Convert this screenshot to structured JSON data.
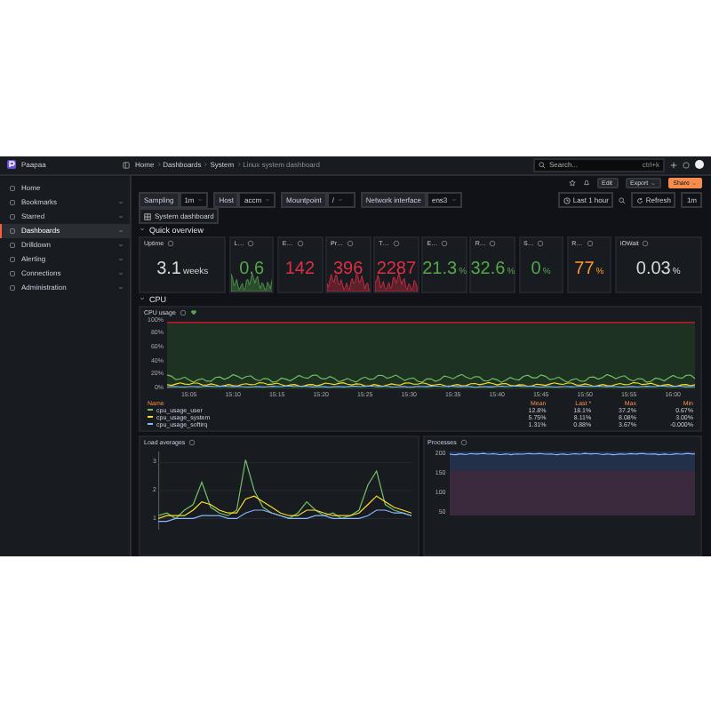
{
  "app": {
    "name": "Paapaa"
  },
  "breadcrumbs": [
    "Home",
    "Dashboards",
    "System",
    "Linux system dashboard"
  ],
  "search": {
    "placeholder": "Search...",
    "shortcut": "ctrl+k"
  },
  "sidebar": {
    "items": [
      {
        "label": "Home",
        "selected": false,
        "expandable": false
      },
      {
        "label": "Bookmarks",
        "selected": false,
        "expandable": true
      },
      {
        "label": "Starred",
        "selected": false,
        "expandable": true
      },
      {
        "label": "Dashboards",
        "selected": true,
        "expandable": true
      },
      {
        "label": "Drilldown",
        "selected": false,
        "expandable": true
      },
      {
        "label": "Alerting",
        "selected": false,
        "expandable": true
      },
      {
        "label": "Connections",
        "selected": false,
        "expandable": true
      },
      {
        "label": "Administration",
        "selected": false,
        "expandable": true
      }
    ]
  },
  "toolbar": {
    "buttons": [
      {
        "label": "Edit",
        "kind": "plain"
      },
      {
        "label": "Export",
        "kind": "dropdown"
      },
      {
        "label": "Share",
        "kind": "primary"
      }
    ]
  },
  "variables": [
    {
      "label": "Sampling",
      "value": "1m"
    },
    {
      "label": "Host",
      "value": "accm"
    },
    {
      "label": "Mountpoint",
      "value": "/"
    },
    {
      "label": "Network interface",
      "value": "ens3"
    }
  ],
  "time_range": "Last 1 hour",
  "refresh": {
    "label": "Refresh",
    "interval": "1m"
  },
  "dashboard_link": "System dashboard",
  "quick_overview": {
    "title": "Quick overview",
    "expanded": true,
    "stats": [
      {
        "title": "Uptime",
        "value": "3.1",
        "unit": "weeks",
        "color": "#d8d9da",
        "graph": false
      },
      {
        "title": "L…",
        "value": "0.6",
        "color": "#56a64b",
        "graph": true
      },
      {
        "title": "E…",
        "value": "142",
        "color": "#e02f44",
        "graph": false
      },
      {
        "title": "Pr…",
        "value": "396",
        "color": "#e02f44",
        "graph": true
      },
      {
        "title": "T…",
        "value": "2287",
        "color": "#e02f44",
        "graph": true
      },
      {
        "title": "E…",
        "value": "21.3",
        "unit": "%",
        "color": "#56a64b",
        "graph": false
      },
      {
        "title": "R…",
        "value": "32.6",
        "unit": "%",
        "color": "#56a64b",
        "graph": false
      },
      {
        "title": "S…",
        "value": "0",
        "unit": "%",
        "color": "#56a64b",
        "graph": false
      },
      {
        "title": "R…",
        "value": "77",
        "unit": "%",
        "color": "#ff9830",
        "graph": false
      },
      {
        "title": "IOWait",
        "value": "0.03",
        "unit": "%",
        "color": "#d8d9da",
        "graph": false
      }
    ]
  },
  "cpu": {
    "title": "CPU",
    "expanded": true,
    "panel": {
      "title": "CPU usage",
      "yticks": [
        "100%",
        "80%",
        "60%",
        "40%",
        "20%",
        "0%"
      ],
      "xticks": [
        "15:05",
        "15:10",
        "15:15",
        "15:20",
        "15:25",
        "15:30",
        "15:35",
        "15:40",
        "15:45",
        "15:50",
        "15:55",
        "16:00"
      ],
      "legend_columns": [
        "Name",
        "Mean",
        "Last *",
        "Max",
        "Min"
      ],
      "legend_rows": [
        {
          "name": "cpu_usage_user",
          "color": "#73bf69",
          "cells": [
            "12.8%",
            "18.1%",
            "37.2%",
            "0.67%"
          ]
        },
        {
          "name": "cpu_usage_system",
          "color": "#fade2a",
          "cells": [
            "5.75%",
            "8.11%",
            "8.08%",
            "3.00%"
          ]
        },
        {
          "name": "cpu_usage_softirq",
          "color": "#8ab8ff",
          "cells": [
            "1.31%",
            "0.88%",
            "3.67%",
            "-0.000%"
          ]
        }
      ]
    }
  },
  "load_panel": {
    "title": "Load averages",
    "chart_data": {
      "type": "line",
      "grid": true,
      "ylim": [
        0.6,
        3.4
      ],
      "yticks": [
        3,
        2,
        1
      ],
      "series": [
        {
          "color": "#73bf69",
          "values": [
            1.1,
            1.2,
            1.0,
            1.3,
            1.5,
            2.3,
            1.4,
            1.2,
            1.1,
            1.3,
            3.1,
            2.0,
            1.4,
            1.2,
            1.1,
            1.0,
            1.2,
            1.6,
            1.3,
            1.1,
            1.2,
            1.0,
            1.1,
            1.3,
            2.2,
            2.7,
            1.5,
            1.3,
            1.2,
            1.1
          ]
        },
        {
          "color": "#fade2a",
          "values": [
            1.0,
            1.1,
            1.1,
            1.1,
            1.3,
            1.6,
            1.5,
            1.3,
            1.2,
            1.2,
            1.7,
            1.8,
            1.6,
            1.4,
            1.2,
            1.1,
            1.1,
            1.3,
            1.3,
            1.2,
            1.1,
            1.1,
            1.1,
            1.2,
            1.5,
            1.8,
            1.6,
            1.4,
            1.3,
            1.2
          ]
        },
        {
          "color": "#8ab8ff",
          "values": [
            0.9,
            0.9,
            1.0,
            1.0,
            1.0,
            1.1,
            1.1,
            1.1,
            1.0,
            1.0,
            1.2,
            1.3,
            1.3,
            1.2,
            1.1,
            1.0,
            1.0,
            1.0,
            1.1,
            1.1,
            1.0,
            1.0,
            1.0,
            1.0,
            1.1,
            1.3,
            1.3,
            1.2,
            1.2,
            1.1
          ]
        }
      ]
    }
  },
  "processes_panel": {
    "title": "Processes",
    "yticks": [
      "200",
      "150",
      "100",
      "50"
    ]
  }
}
